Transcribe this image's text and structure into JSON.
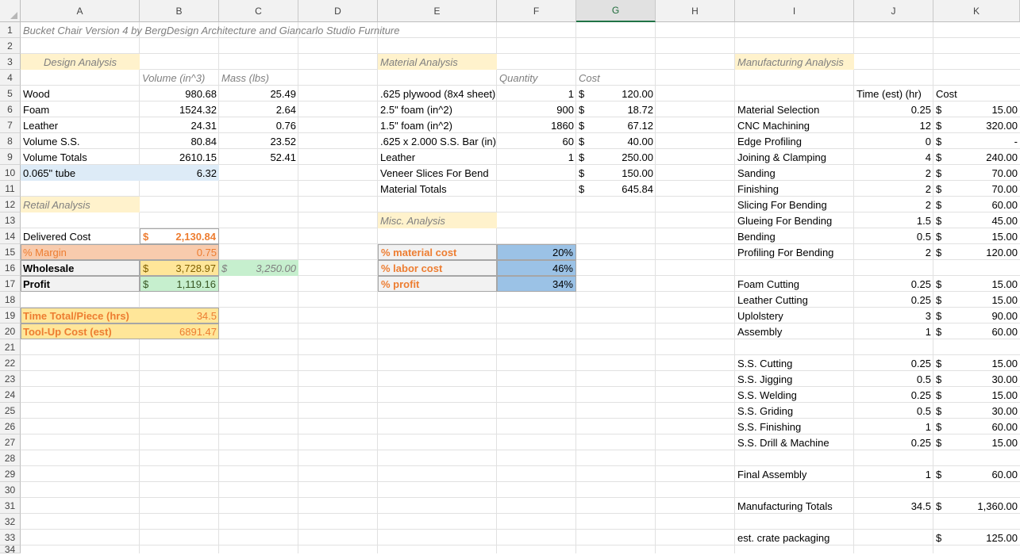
{
  "columns": [
    "A",
    "B",
    "C",
    "D",
    "E",
    "F",
    "G",
    "H",
    "I",
    "J",
    "K"
  ],
  "selected_column": "G",
  "rows": [
    "1",
    "2",
    "3",
    "4",
    "5",
    "6",
    "7",
    "8",
    "9",
    "10",
    "11",
    "12",
    "13",
    "14",
    "15",
    "16",
    "17",
    "18",
    "19",
    "20",
    "21",
    "22",
    "23",
    "24",
    "25",
    "26",
    "27",
    "28",
    "29",
    "30",
    "31",
    "32",
    "33",
    "34"
  ],
  "title": "Bucket Chair Version 4 by BergDesign Architecture and Giancarlo Studio Furniture",
  "design": {
    "header": "Design Analysis",
    "col_volume": "Volume (in^3)",
    "col_mass": "Mass (lbs)",
    "rows": [
      {
        "label": "Wood",
        "volume": "980.68",
        "mass": "25.49"
      },
      {
        "label": "Foam",
        "volume": "1524.32",
        "mass": "2.64"
      },
      {
        "label": "Leather",
        "volume": "24.31",
        "mass": "0.76"
      },
      {
        "label": "Volume S.S.",
        "volume": "80.84",
        "mass": "23.52"
      },
      {
        "label": "Volume Totals",
        "volume": "2610.15",
        "mass": "52.41"
      }
    ],
    "tube_label": "0.065\" tube",
    "tube_value": "6.32"
  },
  "retail": {
    "header": "Retail Analysis",
    "delivered_label": "Delivered Cost",
    "delivered_value": "2,130.84",
    "margin_label": "% Margin",
    "margin_value": "0.75",
    "wholesale_label": "Wholesale",
    "wholesale_value": "3,728.97",
    "wholesale_alt": "3,250.00",
    "profit_label": "Profit",
    "profit_value": "1,119.16",
    "time_label": "Time Total/Piece (hrs)",
    "time_value": "34.5",
    "toolup_label": "Tool-Up Cost (est)",
    "toolup_value": "6891.47",
    "currency": "$"
  },
  "material": {
    "header": "Material Analysis",
    "col_quantity": "Quantity",
    "col_cost": "Cost",
    "rows": [
      {
        "label": ".625 plywood (8x4 sheet)",
        "qty": "1",
        "cost": "120.00"
      },
      {
        "label": "2.5\" foam (in^2)",
        "qty": "900",
        "cost": "18.72"
      },
      {
        "label": "1.5\" foam (in^2)",
        "qty": "1860",
        "cost": "67.12"
      },
      {
        "label": ".625 x 2.000 S.S. Bar (in)",
        "qty": "60",
        "cost": "40.00"
      },
      {
        "label": "Leather",
        "qty": "1",
        "cost": "250.00"
      },
      {
        "label": "Veneer Slices For Bend",
        "qty": "",
        "cost": "150.00"
      }
    ],
    "totals_label": "Material Totals",
    "totals_value": "645.84",
    "currency": "$"
  },
  "misc": {
    "header": "Misc. Analysis",
    "rows": [
      {
        "label": "% material cost",
        "value": "20%"
      },
      {
        "label": "% labor cost",
        "value": "46%"
      },
      {
        "label": "% profit",
        "value": "34%"
      }
    ]
  },
  "manufacturing": {
    "header": "Manufacturing Analysis",
    "col_time": "Time (est) (hr)",
    "col_cost": "Cost",
    "currency": "$",
    "rows": [
      {
        "row": 6,
        "label": "Material Selection",
        "time": "0.25",
        "cost": "15.00"
      },
      {
        "row": 7,
        "label": "CNC Machining",
        "time": "12",
        "cost": "320.00"
      },
      {
        "row": 8,
        "label": "Edge Profiling",
        "time": "0",
        "cost": "-"
      },
      {
        "row": 9,
        "label": "Joining & Clamping",
        "time": "4",
        "cost": "240.00"
      },
      {
        "row": 10,
        "label": "Sanding",
        "time": "2",
        "cost": "70.00"
      },
      {
        "row": 11,
        "label": "Finishing",
        "time": "2",
        "cost": "70.00"
      },
      {
        "row": 12,
        "label": "Slicing For Bending",
        "time": "2",
        "cost": "60.00"
      },
      {
        "row": 13,
        "label": "Glueing For Bending",
        "time": "1.5",
        "cost": "45.00"
      },
      {
        "row": 14,
        "label": "Bending",
        "time": "0.5",
        "cost": "15.00"
      },
      {
        "row": 15,
        "label": "Profiling For Bending",
        "time": "2",
        "cost": "120.00"
      },
      {
        "row": 17,
        "label": "Foam Cutting",
        "time": "0.25",
        "cost": "15.00"
      },
      {
        "row": 18,
        "label": "Leather Cutting",
        "time": "0.25",
        "cost": "15.00"
      },
      {
        "row": 19,
        "label": "Uplolstery",
        "time": "3",
        "cost": "90.00"
      },
      {
        "row": 20,
        "label": "Assembly",
        "time": "1",
        "cost": "60.00"
      },
      {
        "row": 22,
        "label": "S.S. Cutting",
        "time": "0.25",
        "cost": "15.00"
      },
      {
        "row": 23,
        "label": "S.S. Jigging",
        "time": "0.5",
        "cost": "30.00"
      },
      {
        "row": 24,
        "label": "S.S. Welding",
        "time": "0.25",
        "cost": "15.00"
      },
      {
        "row": 25,
        "label": "S.S. Griding",
        "time": "0.5",
        "cost": "30.00"
      },
      {
        "row": 26,
        "label": "S.S. Finishing",
        "time": "1",
        "cost": "60.00"
      },
      {
        "row": 27,
        "label": "S.S. Drill & Machine",
        "time": "0.25",
        "cost": "15.00"
      },
      {
        "row": 29,
        "label": "Final Assembly",
        "time": "1",
        "cost": "60.00"
      },
      {
        "row": 31,
        "label": "Manufacturing Totals",
        "time": "34.5",
        "cost": "1,360.00"
      },
      {
        "row": 33,
        "label": "est. crate packaging",
        "time": "",
        "cost": "125.00"
      }
    ]
  },
  "colors": {
    "header_fill": "#f2f2f2",
    "selected_header": "#217346",
    "section_fill": "#fff2cc",
    "tube_fill": "#ddebf7",
    "margin_fill": "#f8cbad",
    "wholesale_fill": "#ffe699",
    "wholesale_alt_fill": "#c6efce",
    "profit_fill": "#c6efce",
    "time_fill": "#ffe699",
    "misc_label_fill": "#f2f2f2",
    "misc_value_fill": "#9bc2e6",
    "accent_text": "#ed7d31"
  }
}
